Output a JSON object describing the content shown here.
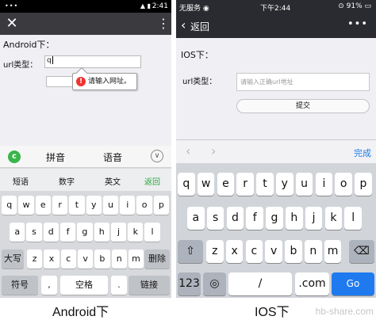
{
  "android": {
    "status": {
      "left": "•••",
      "icons": "▲ ▮",
      "time": "2:41"
    },
    "titlebar": {
      "close_icon": "✕",
      "more_icon": "⋮"
    },
    "heading": "Android下：",
    "url_label": "url类型：",
    "url_value": "q",
    "tooltip": {
      "icon": "!",
      "text": "请输入网址。"
    },
    "candidates": {
      "logo": "c",
      "items": [
        "拼音",
        "语音"
      ],
      "collapse_icon": "∨"
    },
    "modes": [
      "短语",
      "数字",
      "英文",
      "返回"
    ],
    "return_color": "#2aa63a",
    "keys_row1": [
      "q",
      "w",
      "e",
      "r",
      "t",
      "y",
      "u",
      "i",
      "o",
      "p"
    ],
    "keys_row2": [
      "a",
      "s",
      "d",
      "f",
      "g",
      "h",
      "j",
      "k",
      "l"
    ],
    "keys_row3": [
      "大写",
      "z",
      "x",
      "c",
      "v",
      "b",
      "n",
      "m",
      "删除"
    ],
    "keys_row4": [
      "符号",
      ",",
      "空格",
      ".",
      "链接"
    ]
  },
  "ios": {
    "status": {
      "carrier": "无服务 ◉",
      "time": "下午2:44",
      "battery": "⊙ 91% ▭"
    },
    "nav": {
      "back_icon": "‹",
      "back_label": "返回",
      "more_icon": "•••"
    },
    "heading": "IOS下：",
    "url_label": "url类型：",
    "url_placeholder": "请输入正确url地址",
    "submit_label": "提交",
    "accessory": {
      "prev_icon": "‹",
      "next_icon": "›",
      "done_label": "完成"
    },
    "done_color": "#1b7ce9",
    "keys_row1": [
      "q",
      "w",
      "e",
      "r",
      "t",
      "y",
      "u",
      "i",
      "o",
      "p"
    ],
    "keys_row2": [
      "a",
      "s",
      "d",
      "f",
      "g",
      "h",
      "j",
      "k",
      "l"
    ],
    "keys_row3": [
      "⇧",
      "z",
      "x",
      "c",
      "v",
      "b",
      "n",
      "m",
      "⌫"
    ],
    "keys_row4": [
      "123",
      "◎",
      "/",
      ".com",
      "Go"
    ]
  },
  "captions": {
    "android": "Android下",
    "ios": "IOS下"
  },
  "watermark": "hb-share.com"
}
